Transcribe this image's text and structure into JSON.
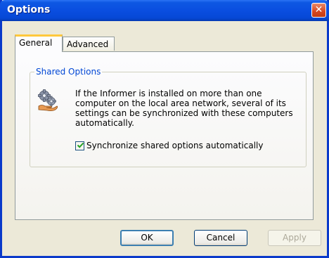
{
  "window": {
    "title": "Options",
    "close_glyph": "✕"
  },
  "tabs": [
    {
      "label": "General",
      "active": true
    },
    {
      "label": "Advanced",
      "active": false
    }
  ],
  "group": {
    "title": "Shared Options",
    "icon": "gear-icon",
    "description": "If the Informer is installed on more than one computer on the local area network, several of its settings can be synchronized with these computers automatically.",
    "checkbox": {
      "label": "Synchronize shared options automatically",
      "checked": true
    }
  },
  "buttons": {
    "ok": "OK",
    "cancel": "Cancel",
    "apply": "Apply"
  },
  "colors": {
    "titlebar": "#0a4ee0",
    "group_title": "#0046d5",
    "tab_highlight": "#ffc83c"
  }
}
